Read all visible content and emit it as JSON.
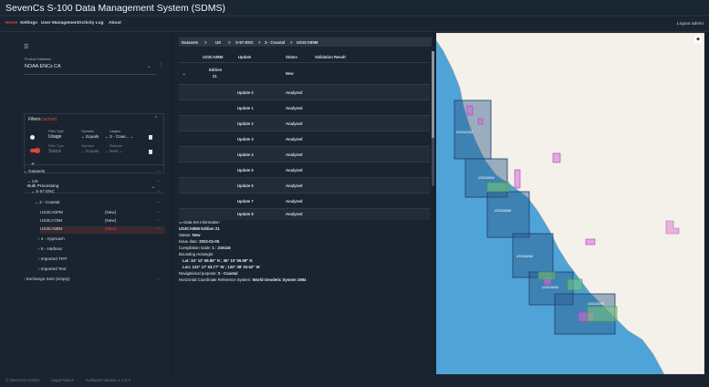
{
  "app": {
    "title": "SevenCs S-100 Data Management System (SDMS)"
  },
  "menu": {
    "items": [
      "Home",
      "Settings",
      "User Management",
      "Activity Log",
      "About"
    ],
    "logout": "Logout admin"
  },
  "sidebar": {
    "product_db_label": "Product Database",
    "product_db_value": "NOAA ENCs CA",
    "filters_title": "Filters",
    "filters_active": "(active)",
    "filter1": {
      "type_label": "Filter Type",
      "type": "Usage",
      "op_label": "Operator",
      "op": "Equals",
      "usages_label": "Usages",
      "usages": "3 - Coas..."
    },
    "filter2": {
      "type_label": "Filter Type",
      "type": "Status",
      "op_label": "Operator",
      "op": "Equals",
      "statuses_label": "Statuses",
      "statuses": "New"
    },
    "bulk": "Bulk Processing",
    "tree": {
      "datasets": "Datasets",
      "us": "US",
      "s57": "S-57 ENC",
      "coastal": "3 - Coastal",
      "cells": [
        {
          "name": "US3CA5PM",
          "status": "(New)"
        },
        {
          "name": "US3CA70M",
          "status": "(New)"
        },
        {
          "name": "US3CA85M",
          "status": "(New)"
        }
      ],
      "approach": "4 - Approach",
      "harbour": "5 - Harbour",
      "tiff": "Imported TIFF",
      "text": "Imported Text",
      "exchange": "Exchange Sets (empty)"
    }
  },
  "breadcrumb": [
    "Datasets",
    ">",
    "US",
    ">",
    "S-57 ENC",
    ">",
    "3 - Coastal",
    ">",
    "US3CA85M"
  ],
  "grid": {
    "headers": [
      "US3CA85M",
      "Update",
      "Status",
      "Validation Result"
    ],
    "edition_label": "Edition",
    "edition_num": "21",
    "edition_status": "New",
    "rows": [
      {
        "update": "Update 0",
        "status": "Analyzed"
      },
      {
        "update": "Update 1",
        "status": "Analyzed"
      },
      {
        "update": "Update 2",
        "status": "Analyzed"
      },
      {
        "update": "Update 3",
        "status": "Analyzed"
      },
      {
        "update": "Update 4",
        "status": "Analyzed"
      },
      {
        "update": "Update 5",
        "status": "Analyzed"
      },
      {
        "update": "Update 6",
        "status": "Analyzed"
      },
      {
        "update": "Update 7",
        "status": "Analyzed"
      },
      {
        "update": "Update 8",
        "status": "Analyzed"
      }
    ]
  },
  "info": {
    "heading": "Data Set Information",
    "edition": "US3CA85M Edition 21",
    "status_label": "Status:",
    "status": "New",
    "issue_label": "Issue date:",
    "issue": "2022-01-05",
    "scale_label": "Compilation scale:",
    "scale": "1 : 216116",
    "bbox_label": "Bounding rectangle:",
    "lat": "Lat: 34° 12' 59.85\" N ; 36° 10' 59.98\" N",
    "lon": "Lon: 122° 17' 03.77\" W ; 120° 38' 03.52\" W",
    "purpose_label": "Navigational purpose:",
    "purpose": "3 - Coastal",
    "crs_label": "Horizontal Coordinate Reference System:",
    "crs": "World Geodetic System 1984"
  },
  "map": {
    "labels": [
      "US3CA10M",
      "US3CA50M",
      "US3CA85M",
      "US3CA65M",
      "US3CA68M",
      "US3CA69M"
    ],
    "water_color": "#4fa3d6",
    "land_color": "#f4f1ea",
    "cell_color": "#2a5a8c"
  },
  "footer": {
    "company": "© SevenCs GmbH",
    "legal": "Legal Notice",
    "version": "Software Version 1.1.0.4"
  }
}
